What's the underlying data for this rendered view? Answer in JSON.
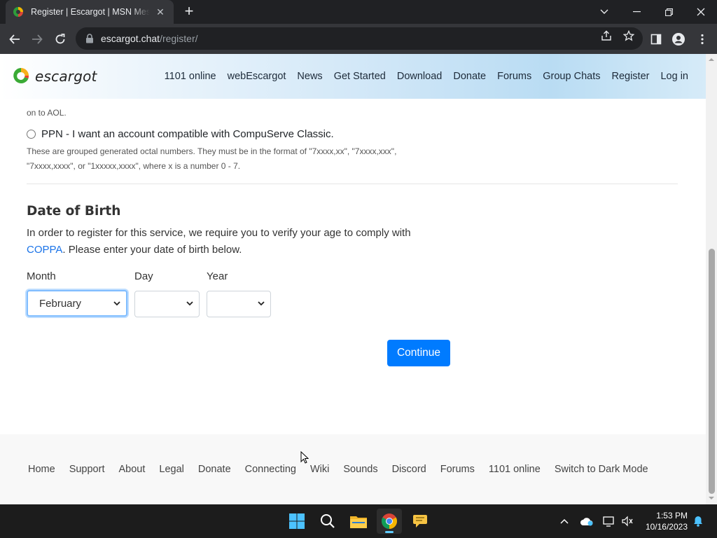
{
  "browser": {
    "tab_title": "Register | Escargot | MSN Messenger",
    "url_host": "escargot.chat",
    "url_path": "/register/"
  },
  "site": {
    "logo_text": "escargot",
    "nav": [
      "1101 online",
      "webEscargot",
      "News",
      "Get Started",
      "Download",
      "Donate",
      "Forums",
      "Group Chats",
      "Register",
      "Log in"
    ]
  },
  "form": {
    "clipped_text": "on to AOL.",
    "ppn_label": "PPN - I want an account compatible with CompuServe Classic.",
    "ppn_hint": "These are grouped generated octal numbers. They must be in the format of \"7xxxx,xx\", \"7xxxx,xxx\", \"7xxxx,xxxx\", or \"1xxxxx,xxxx\", where x is a number 0 - 7.",
    "dob_title": "Date of Birth",
    "dob_desc_before": "In order to register for this service, we require you to verify your age to comply with",
    "dob_link": "COPPA",
    "dob_desc_after": ". Please enter your date of birth below.",
    "month_label": "Month",
    "day_label": "Day",
    "year_label": "Year",
    "month_value": "February",
    "day_value": "",
    "year_value": "",
    "continue_label": "Continue"
  },
  "footer": {
    "links": [
      "Home",
      "Support",
      "About",
      "Legal",
      "Donate",
      "Connecting",
      "Wiki",
      "Sounds",
      "Discord",
      "Forums",
      "1101 online",
      "Switch to Dark Mode"
    ]
  },
  "taskbar": {
    "time": "1:53 PM",
    "date": "10/16/2023"
  },
  "colors": {
    "primary": "#007bff",
    "link": "#1a73e8",
    "focus": "#80bdff"
  }
}
